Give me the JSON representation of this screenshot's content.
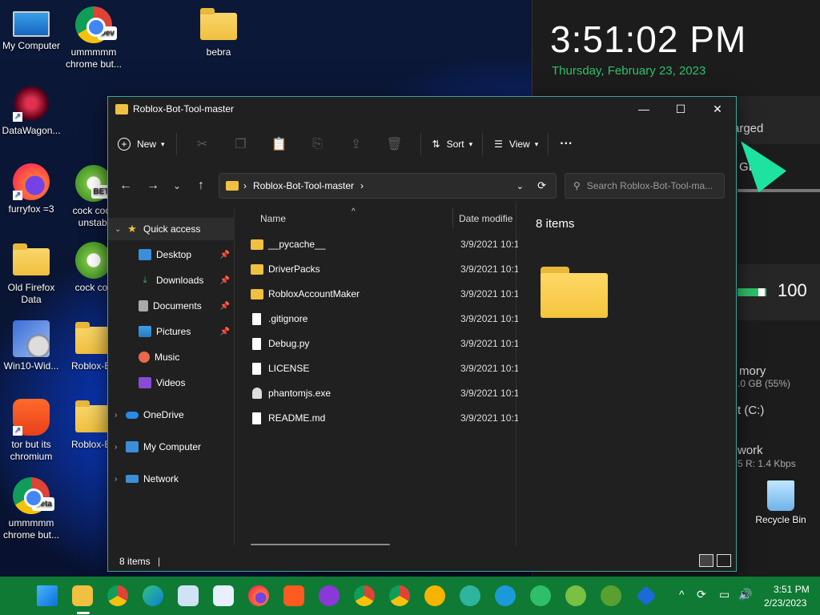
{
  "desktop": {
    "icons": [
      {
        "label": "My Computer"
      },
      {
        "label": "ummmmm chrome but...",
        "badge": "Dev"
      },
      {
        "label": "bebra"
      },
      {
        "label": "DataWagon..."
      },
      {
        "label": "furryfox =3"
      },
      {
        "label": "cock cock unstabl",
        "badge": "BETA"
      },
      {
        "label": "Old Firefox Data"
      },
      {
        "label": "cock coc"
      },
      {
        "label": "Win10-Wid..."
      },
      {
        "label": "Roblox-Bo"
      },
      {
        "label": "tor but its chromium"
      },
      {
        "label": "Roblox-Bo"
      },
      {
        "label": "ummmmm chrome but...",
        "badge": "Beta"
      },
      {
        "label": "Recycle Bin"
      }
    ]
  },
  "widget": {
    "time": "3:51:02 PM",
    "date": "Thursday, February 23, 2023",
    "battery_partial": "arged",
    "gb_partial": "GB",
    "volume": "100",
    "memory_label_partial": "mory",
    "memory_value_partial": ".0 GB (55%)",
    "disk_partial": "t (C:)",
    "network_partial": "work",
    "network_rate_partial": "5 R: 1.4 Kbps"
  },
  "explorer": {
    "title": "Roblox-Bot-Tool-master",
    "toolbar": {
      "new_label": "New",
      "sort_label": "Sort",
      "view_label": "View",
      "more_label": "···"
    },
    "address": {
      "path": "Roblox-Bot-Tool-master",
      "search_placeholder": "Search Roblox-Bot-Tool-ma..."
    },
    "nav": [
      {
        "label": "Quick access",
        "pinned": false
      },
      {
        "label": "Desktop",
        "pinned": true
      },
      {
        "label": "Downloads",
        "pinned": true
      },
      {
        "label": "Documents",
        "pinned": true
      },
      {
        "label": "Pictures",
        "pinned": true
      },
      {
        "label": "Music",
        "pinned": false
      },
      {
        "label": "Videos",
        "pinned": false
      },
      {
        "label": "OneDrive",
        "pinned": false
      },
      {
        "label": "My Computer",
        "pinned": false
      },
      {
        "label": "Network",
        "pinned": false
      }
    ],
    "columns": {
      "name": "Name",
      "date": "Date modifie"
    },
    "files": [
      {
        "name": "__pycache__",
        "date": "3/9/2021 10:1",
        "type": "folder"
      },
      {
        "name": "DriverPacks",
        "date": "3/9/2021 10:1",
        "type": "folder"
      },
      {
        "name": "RobloxAccountMaker",
        "date": "3/9/2021 10:1",
        "type": "folder"
      },
      {
        "name": ".gitignore",
        "date": "3/9/2021 10:1",
        "type": "file"
      },
      {
        "name": "Debug.py",
        "date": "3/9/2021 10:1",
        "type": "file"
      },
      {
        "name": "LICENSE",
        "date": "3/9/2021 10:1",
        "type": "file"
      },
      {
        "name": "phantomjs.exe",
        "date": "3/9/2021 10:1",
        "type": "exe"
      },
      {
        "name": "README.md",
        "date": "3/9/2021 10:1",
        "type": "file"
      }
    ],
    "preview_text": "8 items",
    "status_text": "8 items"
  },
  "taskbar": {
    "time": "3:51 PM",
    "date": "2/23/2023"
  },
  "colors": {
    "accent_green": "#2fbf6a",
    "taskbar": "#0f7a34",
    "window_border": "#3aa3a3"
  }
}
